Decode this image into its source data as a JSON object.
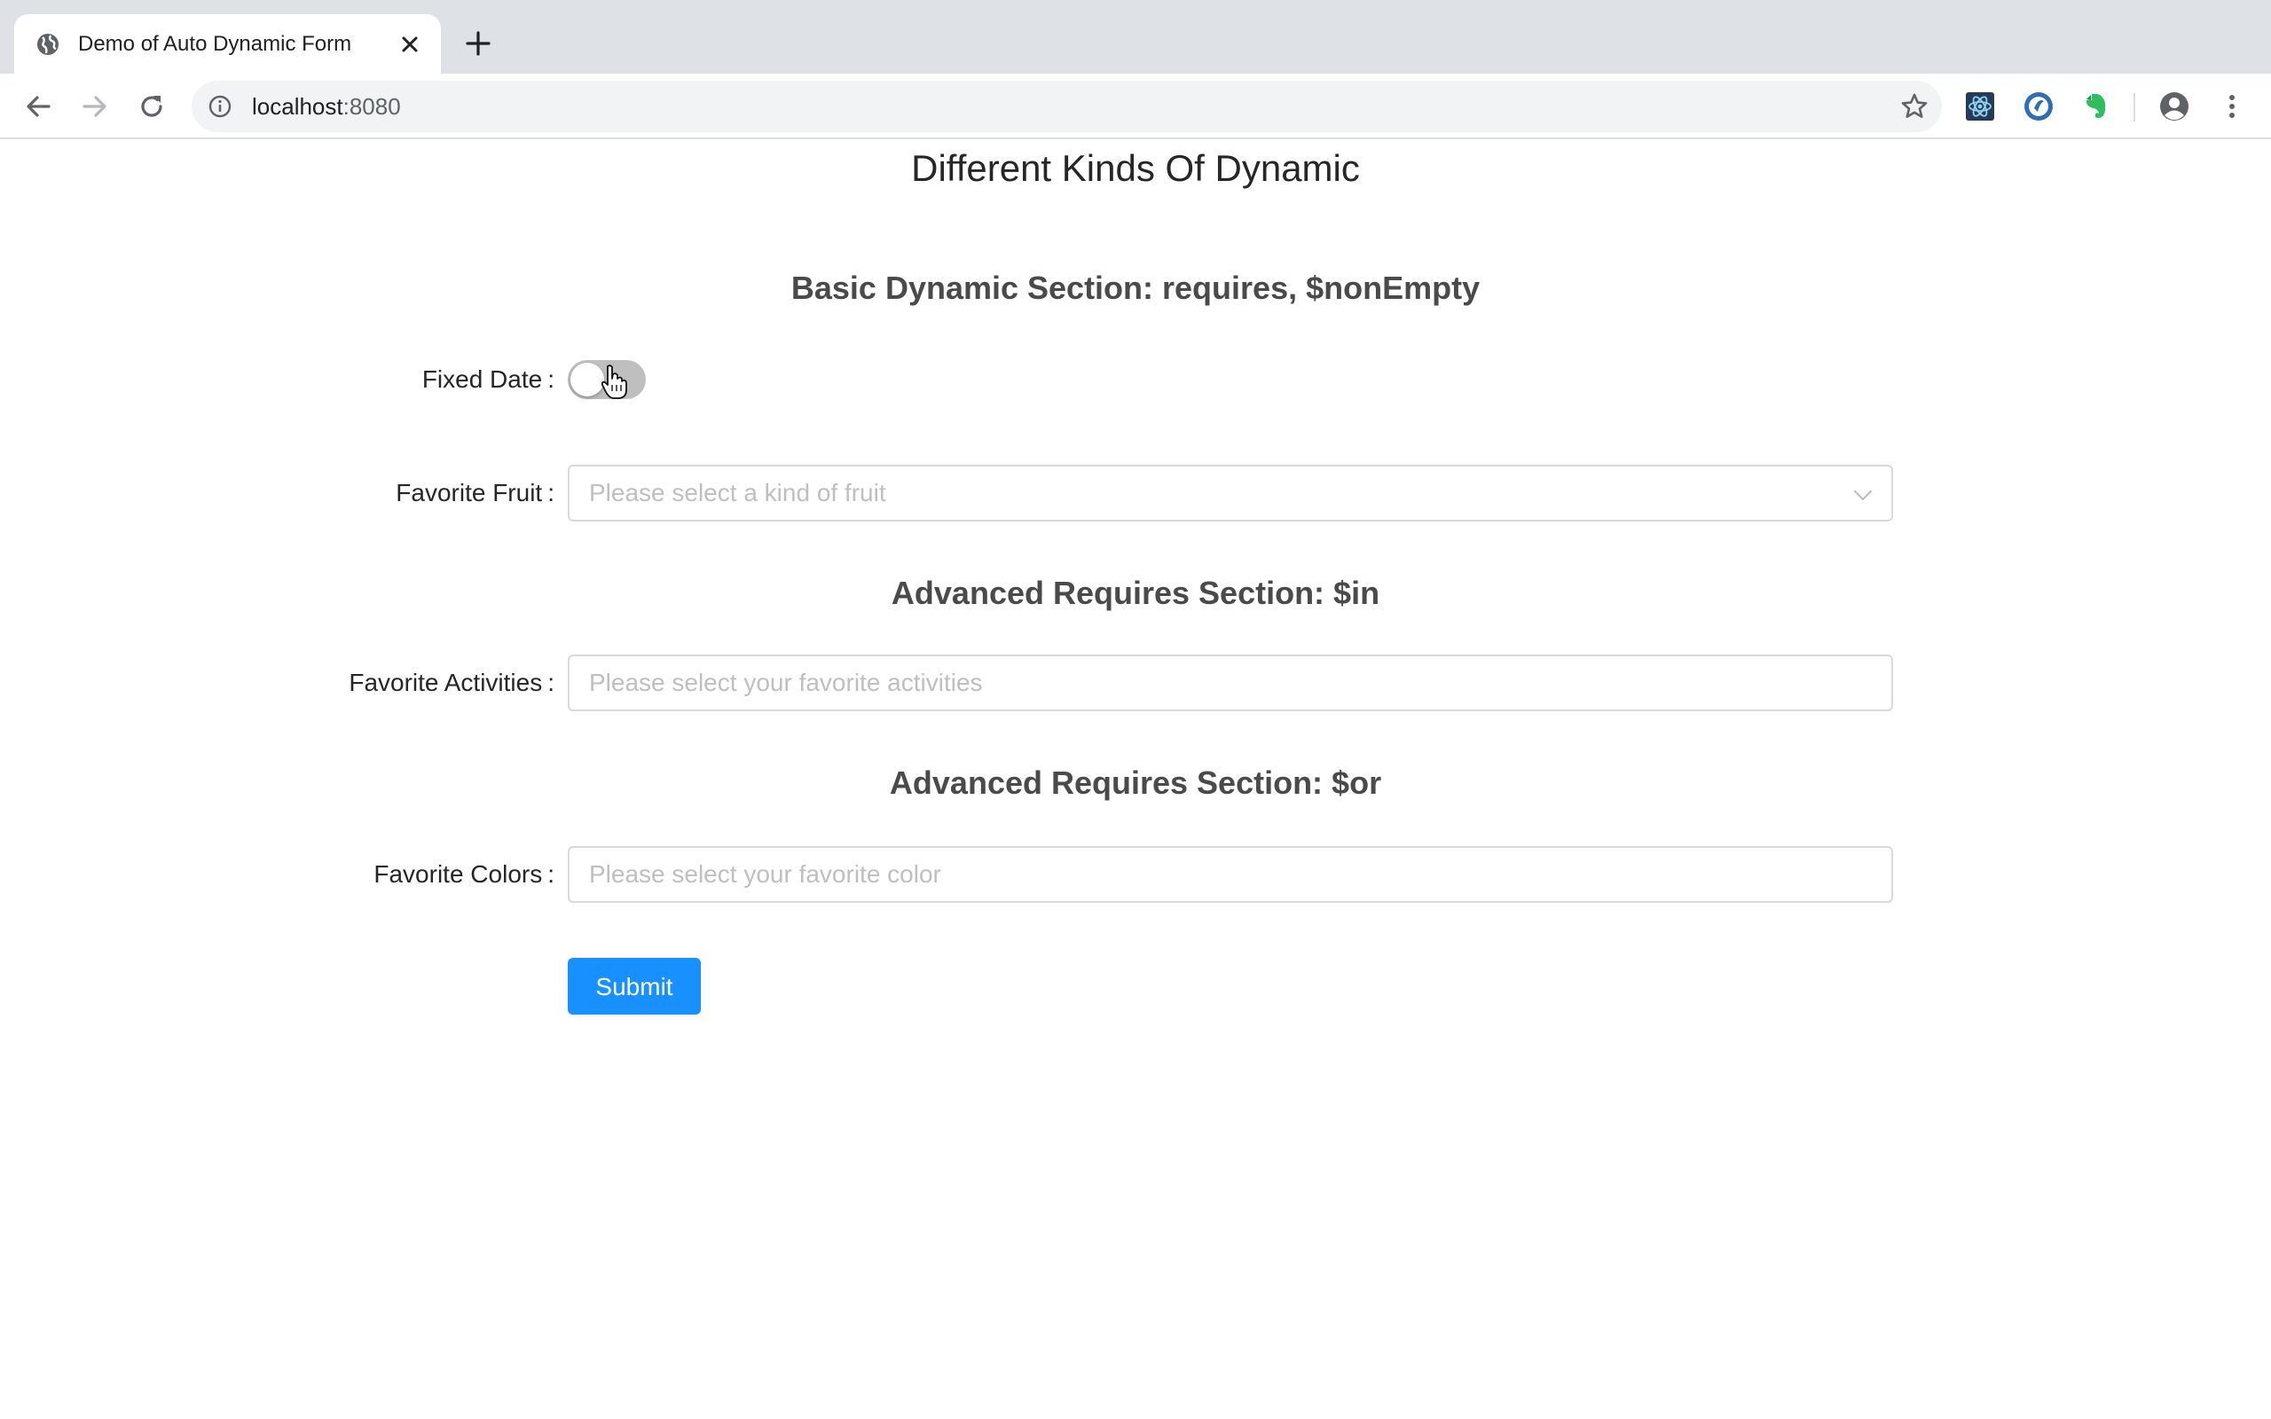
{
  "browser": {
    "tab_title": "Demo of Auto Dynamic Form",
    "url_host": "localhost",
    "url_port": ":8080"
  },
  "page": {
    "title": "Different Kinds Of Dynamic"
  },
  "sections": {
    "basic_title": "Basic Dynamic Section: requires, $nonEmpty",
    "in_title": "Advanced Requires Section: $in",
    "or_title": "Advanced Requires Section: $or"
  },
  "fields": {
    "fixed_date": {
      "label": "Fixed Date",
      "checked": false
    },
    "favorite_fruit": {
      "label": "Favorite Fruit",
      "placeholder": "Please select a kind of fruit"
    },
    "favorite_activities": {
      "label": "Favorite Activities",
      "placeholder": "Please select your favorite activities"
    },
    "favorite_colors": {
      "label": "Favorite Colors",
      "placeholder": "Please select your favorite color"
    }
  },
  "colon": ":",
  "submit_label": "Submit",
  "icons": {
    "favicon": "globe-icon",
    "tab_close": "close-icon",
    "new_tab": "plus-icon",
    "back": "arrow-left-icon",
    "forward": "arrow-right-icon",
    "reload": "reload-icon",
    "info": "info-icon",
    "bookmark": "star-icon",
    "profile": "account-icon",
    "menu": "kebab-menu-icon"
  },
  "colors": {
    "primary": "#1890ff",
    "switch_off": "#bfbfbf",
    "placeholder": "#bfbfbf",
    "border": "#d9d9d9"
  }
}
